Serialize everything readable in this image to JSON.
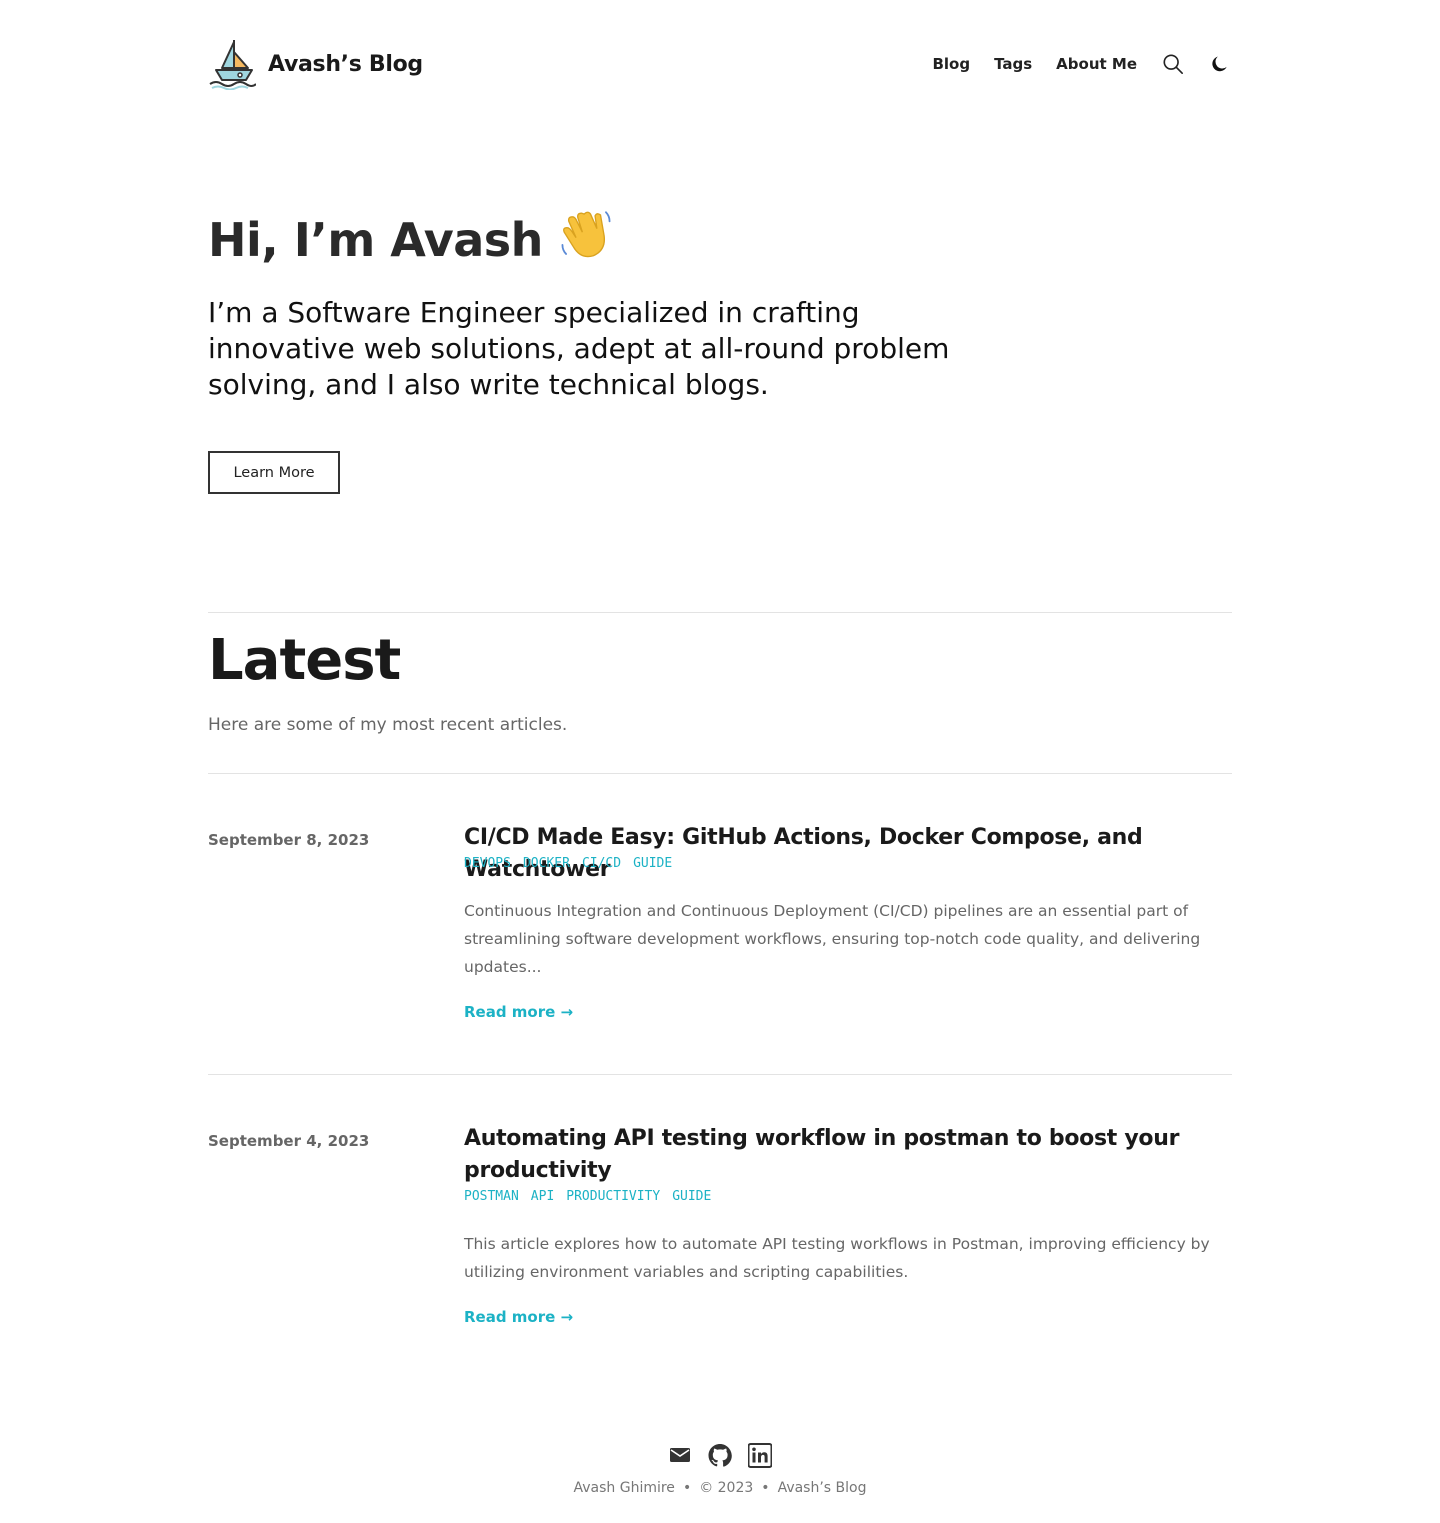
{
  "header": {
    "site_title": "Avash’s Blog",
    "nav": [
      "Blog",
      "Tags",
      "About Me"
    ],
    "icons": [
      "boat-logo-icon",
      "search-icon",
      "moon-icon"
    ]
  },
  "hero": {
    "title": "Hi, I’m Avash",
    "emoji": "waving-hand-icon",
    "subtitle": "I’m a Software Engineer specialized in crafting innovative web solutions, adept at all-round problem solving, and I also write technical blogs.",
    "button_label": "Learn More"
  },
  "latest": {
    "title": "Latest",
    "subtitle": "Here are some of my most recent articles."
  },
  "posts": [
    {
      "date": "September 8, 2023",
      "title": "CI/CD Made Easy: GitHub Actions, Docker Compose, and Watchtower",
      "tags": [
        "devops",
        "docker",
        "ci/cd",
        "guide"
      ],
      "excerpt": "Continuous Integration and Continuous Deployment (CI/CD) pipelines are an essential part of streamlining software development workflows, ensuring top-notch code quality, and delivering updates...",
      "read_more": "Read more →"
    },
    {
      "date": "September 4, 2023",
      "title": "Automating API testing workflow in postman to boost your productivity",
      "tags": [
        "postman",
        "api",
        "productivity",
        "guide"
      ],
      "excerpt": "This article explores how to automate API testing workflows in Postman, improving efficiency by utilizing environment variables and scripting capabilities.",
      "read_more": "Read more →"
    }
  ],
  "footer": {
    "social_icons": [
      "mail-icon",
      "github-icon",
      "linkedin-icon"
    ],
    "author": "Avash Ghimire",
    "separator": "•",
    "copyright": "© 2023",
    "site": "Avash’s Blog"
  },
  "colors": {
    "accent": "#1cb2c5",
    "text": "#1a1a1a",
    "muted": "#666666"
  }
}
